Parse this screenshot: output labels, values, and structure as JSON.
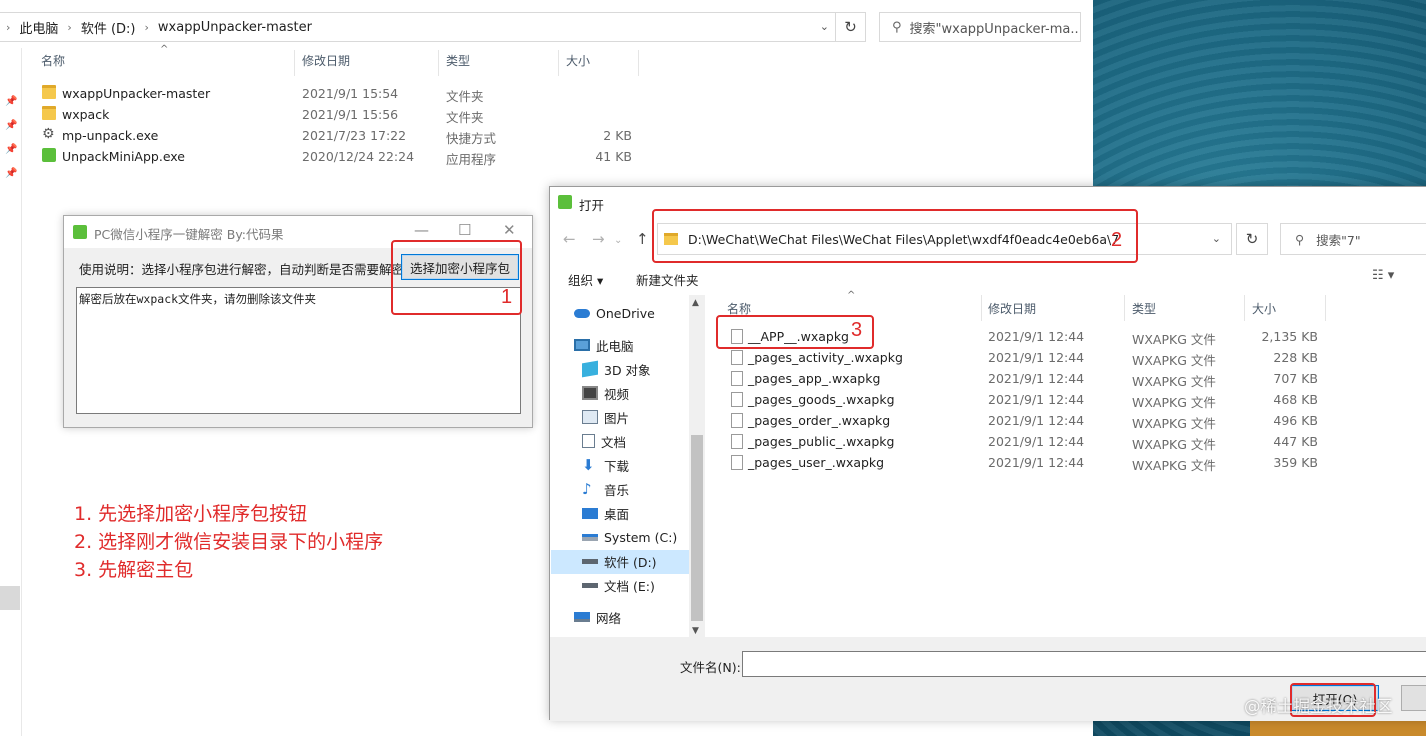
{
  "explorer": {
    "breadcrumb": [
      "此电脑",
      "软件 (D:)",
      "wxappUnpacker-master"
    ],
    "search_placeholder": "搜索\"wxappUnpacker-ma...",
    "columns": [
      "名称",
      "修改日期",
      "类型",
      "大小"
    ],
    "files": [
      {
        "name": "wxappUnpacker-master",
        "date": "2021/9/1 15:54",
        "type": "文件夹",
        "size": "",
        "icon": "folder-icon"
      },
      {
        "name": "wxpack",
        "date": "2021/9/1 15:56",
        "type": "文件夹",
        "size": "",
        "icon": "folder-icon"
      },
      {
        "name": "mp-unpack.exe",
        "date": "2021/7/23 17:22",
        "type": "快捷方式",
        "size": "2 KB",
        "icon": "gear-icon"
      },
      {
        "name": "UnpackMiniApp.exe",
        "date": "2020/12/24 22:24",
        "type": "应用程序",
        "size": "41 KB",
        "icon": "app-icon"
      }
    ]
  },
  "tool": {
    "title": "PC微信小程序一键解密 By:代码果",
    "hint": "使用说明：选择小程序包进行解密，自动判断是否需要解密",
    "button": "选择加密小程序包",
    "log_text": "解密后放在wxpack文件夹，请勿删除该文件夹"
  },
  "annotations": {
    "n1": "1",
    "n2": "2",
    "n3": "3",
    "steps": [
      "1. 先选择加密小程序包按钮",
      "2. 选择刚才微信安装目录下的小程序",
      "3. 先解密主包"
    ]
  },
  "dialog": {
    "title": "打开",
    "address": "D:\\WeChat\\WeChat Files\\WeChat Files\\Applet\\wxdf4f0eadc4e0eb6a\\7",
    "search_placeholder": "搜索\"7\"",
    "organize": "组织 ▾",
    "new_folder": "新建文件夹",
    "sidebar": [
      {
        "label": "OneDrive",
        "icon": "cloud-icon"
      },
      {
        "label": "此电脑",
        "icon": "computer-icon"
      },
      {
        "label": "3D 对象",
        "icon": "cube-icon"
      },
      {
        "label": "视频",
        "icon": "video-icon"
      },
      {
        "label": "图片",
        "icon": "picture-icon"
      },
      {
        "label": "文档",
        "icon": "document-icon"
      },
      {
        "label": "下载",
        "icon": "download-icon"
      },
      {
        "label": "音乐",
        "icon": "music-icon"
      },
      {
        "label": "桌面",
        "icon": "desktop-icon"
      },
      {
        "label": "System (C:)",
        "icon": "drive-icon"
      },
      {
        "label": "软件 (D:)",
        "icon": "drive-icon"
      },
      {
        "label": "文档 (E:)",
        "icon": "drive-icon"
      },
      {
        "label": "网络",
        "icon": "network-icon"
      }
    ],
    "columns": [
      "名称",
      "修改日期",
      "类型",
      "大小"
    ],
    "files": [
      {
        "name": "__APP__.wxapkg",
        "date": "2021/9/1 12:44",
        "type": "WXAPKG 文件",
        "size": "2,135 KB"
      },
      {
        "name": "_pages_activity_.wxapkg",
        "date": "2021/9/1 12:44",
        "type": "WXAPKG 文件",
        "size": "228 KB"
      },
      {
        "name": "_pages_app_.wxapkg",
        "date": "2021/9/1 12:44",
        "type": "WXAPKG 文件",
        "size": "707 KB"
      },
      {
        "name": "_pages_goods_.wxapkg",
        "date": "2021/9/1 12:44",
        "type": "WXAPKG 文件",
        "size": "468 KB"
      },
      {
        "name": "_pages_order_.wxapkg",
        "date": "2021/9/1 12:44",
        "type": "WXAPKG 文件",
        "size": "496 KB"
      },
      {
        "name": "_pages_public_.wxapkg",
        "date": "2021/9/1 12:44",
        "type": "WXAPKG 文件",
        "size": "447 KB"
      },
      {
        "name": "_pages_user_.wxapkg",
        "date": "2021/9/1 12:44",
        "type": "WXAPKG 文件",
        "size": "359 KB"
      }
    ],
    "filename_label": "文件名(N):",
    "open_button": "打开(O)"
  },
  "watermark": "@稀土掘金技术社区",
  "colors": {
    "annotation": "#e02b2b",
    "accent": "#0078d7",
    "selection": "#cce8ff"
  }
}
